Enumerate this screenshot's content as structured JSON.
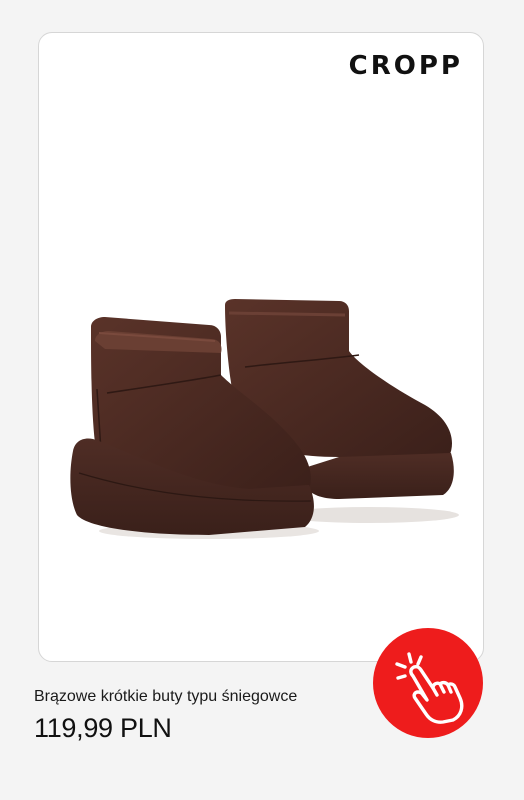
{
  "brand": {
    "logo_text": "CROPP"
  },
  "product": {
    "image_icon": "brown-mini-snow-boots-image",
    "title": "Brązowe krótkie buty typu śniegowce",
    "price": "119,99 PLN"
  },
  "cta": {
    "icon": "tap-hand-icon",
    "color": "#ee1c1c"
  },
  "colors": {
    "boot_brown": "#4a2a22",
    "background": "#f4f4f4"
  }
}
